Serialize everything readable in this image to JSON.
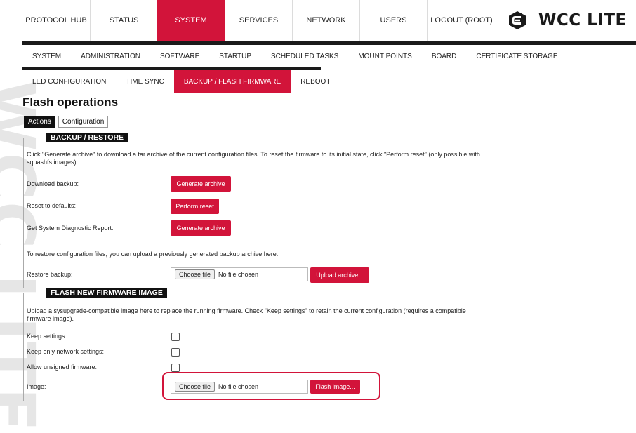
{
  "watermark": "WCC LITE",
  "topnav": {
    "tabs": [
      {
        "label": "PROTOCOL HUB",
        "active": false
      },
      {
        "label": "STATUS",
        "active": false
      },
      {
        "label": "SYSTEM",
        "active": true
      },
      {
        "label": "SERVICES",
        "active": false
      },
      {
        "label": "NETWORK",
        "active": false
      },
      {
        "label": "USERS",
        "active": false
      },
      {
        "label": "LOGOUT (ROOT)",
        "active": false
      }
    ],
    "brand": "WCC LITE"
  },
  "subnav1": {
    "items": [
      "SYSTEM",
      "ADMINISTRATION",
      "SOFTWARE",
      "STARTUP",
      "SCHEDULED TASKS",
      "MOUNT POINTS",
      "BOARD",
      "CERTIFICATE STORAGE"
    ]
  },
  "subnav2": {
    "items": [
      {
        "label": "LED CONFIGURATION",
        "active": false
      },
      {
        "label": "TIME SYNC",
        "active": false
      },
      {
        "label": "BACKUP / FLASH FIRMWARE",
        "active": true
      },
      {
        "label": "REBOOT",
        "active": false
      }
    ]
  },
  "page": {
    "title": "Flash operations",
    "tabs": [
      {
        "label": "Actions",
        "active": true
      },
      {
        "label": "Configuration",
        "active": false
      }
    ]
  },
  "backup": {
    "legend": "BACKUP / RESTORE",
    "description": "Click \"Generate archive\" to download a tar archive of the current configuration files. To reset the firmware to its initial state, click \"Perform reset\" (only possible with squashfs images).",
    "download_label": "Download backup:",
    "download_button": "Generate archive",
    "reset_label": "Reset to defaults:",
    "reset_button": "Perform reset",
    "diag_label": "Get System Diagnostic Report:",
    "diag_button": "Generate archive",
    "restore_text": "To restore configuration files, you can upload a previously generated backup archive here.",
    "restore_label": "Restore backup:",
    "choose_file": "Choose file",
    "no_file": "No file chosen",
    "upload_button": "Upload archive..."
  },
  "flash": {
    "legend": "FLASH NEW FIRMWARE IMAGE",
    "description": "Upload a sysupgrade-compatible image here to replace the running firmware. Check \"Keep settings\" to retain the current configuration (requires a compatible firmware image).",
    "keep_settings_label": "Keep settings:",
    "keep_network_label": "Keep only network settings:",
    "allow_unsigned_label": "Allow unsigned firmware:",
    "image_label": "Image:",
    "choose_file": "Choose file",
    "no_file": "No file chosen",
    "flash_button": "Flash image..."
  },
  "colors": {
    "accent": "#d2143a",
    "dark": "#1a1a1a"
  }
}
